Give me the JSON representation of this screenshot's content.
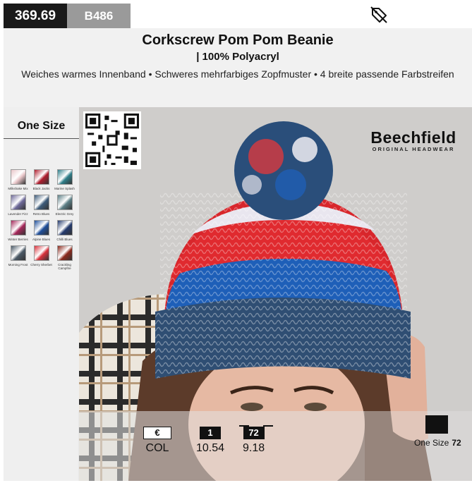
{
  "top": {
    "price_ref": "369.69",
    "code": "B486",
    "tag_icon": "tag-slash-icon"
  },
  "header": {
    "title": "Corkscrew Pom Pom Beanie",
    "subtitle": "| 100% Polyacryl",
    "features": "Weiches warmes Innenband • Schweres mehrfarbiges Zopfmuster • 4 breite passende Farbstreifen"
  },
  "sizes": {
    "title": "One Size"
  },
  "swatches": [
    {
      "label": "Milkshake Mix",
      "color": "#e9c6c9"
    },
    {
      "label": "Black Jacks",
      "color": "#b01e2e"
    },
    {
      "label": "Marine Splash",
      "color": "#2f7f8a"
    },
    {
      "label": "Lavender Fizz",
      "color": "#6f6a9a"
    },
    {
      "label": "Retro Blues",
      "color": "#3d5b7a"
    },
    {
      "label": "Electric Grey",
      "color": "#5c7f86"
    },
    {
      "label": "Winter Berries",
      "color": "#a5285a"
    },
    {
      "label": "Alpine Blues",
      "color": "#1f4f9a"
    },
    {
      "label": "Chilli Blues",
      "color": "#243a6e"
    },
    {
      "label": "Morning Frost",
      "color": "#4a5966"
    },
    {
      "label": "Cherry Sherbet",
      "color": "#d9323b"
    },
    {
      "label": "Crackling Campfire",
      "color": "#8c2a1d"
    }
  ],
  "brand": {
    "name": "Beechfield",
    "tagline": "ORIGINAL HEADWEAR"
  },
  "prices": {
    "currency_symbol": "€",
    "col_label": "COL",
    "qty1_label": "1",
    "qty1_price": "10.54",
    "qty72_label": "72",
    "qty72_price": "9.18"
  },
  "packing": {
    "size": "One Size",
    "qty": "72"
  }
}
